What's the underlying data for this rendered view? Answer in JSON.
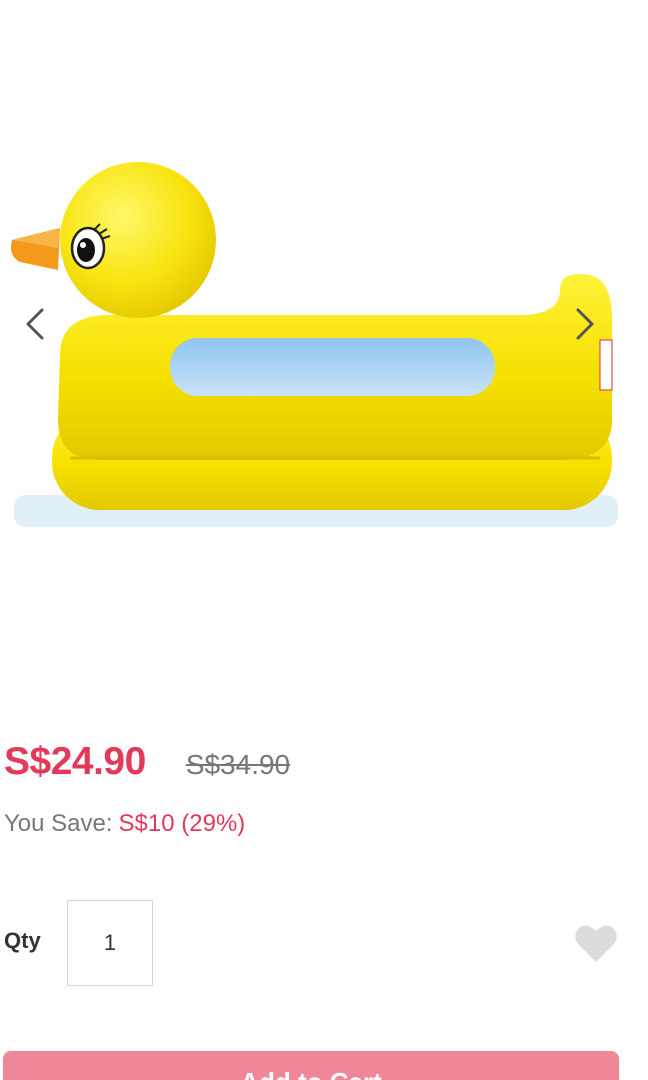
{
  "gallery": {
    "image_icon": "rubber-duck-bathtub-image",
    "prev_icon": "chevron-left-icon",
    "next_icon": "chevron-right-icon"
  },
  "pricing": {
    "current_price": "S$24.90",
    "original_price": "S$34.90",
    "save_label": "You Save:",
    "save_value": "S$10 (29%)"
  },
  "quantity": {
    "label": "Qty",
    "value": "1"
  },
  "wishlist": {
    "icon": "heart-icon"
  },
  "cart": {
    "button_label": "Add to Cart"
  },
  "colors": {
    "price": "#e23a5a",
    "button": "#f08799",
    "muted_text": "#777777"
  }
}
